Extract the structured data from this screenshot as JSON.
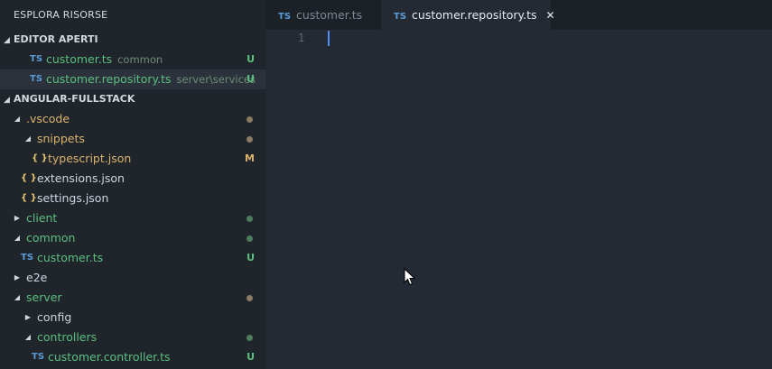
{
  "sidebar": {
    "title": "ESPLORA RISORSE",
    "open_editors": {
      "header": "EDITOR APERTI",
      "items": [
        {
          "name": "customer.ts",
          "desc": "common",
          "status": "U"
        },
        {
          "name": "customer.repository.ts",
          "desc": "server\\services",
          "status": "U"
        }
      ]
    },
    "project": {
      "header": "ANGULAR-FULLSTACK",
      "items": [
        {
          "name": ".vscode"
        },
        {
          "name": "snippets"
        },
        {
          "name": "typescript.json",
          "status": "M"
        },
        {
          "name": "extensions.json"
        },
        {
          "name": "settings.json"
        },
        {
          "name": "client"
        },
        {
          "name": "common"
        },
        {
          "name": "customer.ts",
          "status": "U"
        },
        {
          "name": "e2e"
        },
        {
          "name": "server"
        },
        {
          "name": "config"
        },
        {
          "name": "controllers"
        },
        {
          "name": "customer.controller.ts",
          "status": "U"
        }
      ]
    }
  },
  "icons": {
    "ts": "TS",
    "json": "{ }"
  },
  "tabs": [
    {
      "label": "customer.ts",
      "active": false
    },
    {
      "label": "customer.repository.ts",
      "active": true
    }
  ],
  "tab_close": "✕",
  "editor": {
    "line_number": "1"
  },
  "colors": {
    "sidebar_bg": "#20252c",
    "editor_bg": "#242a33",
    "untracked_green": "#5bbf7f",
    "modified_yellow": "#d9b36c",
    "ts_icon_blue": "#5a9bd5",
    "cursor_blue": "#528bff"
  }
}
